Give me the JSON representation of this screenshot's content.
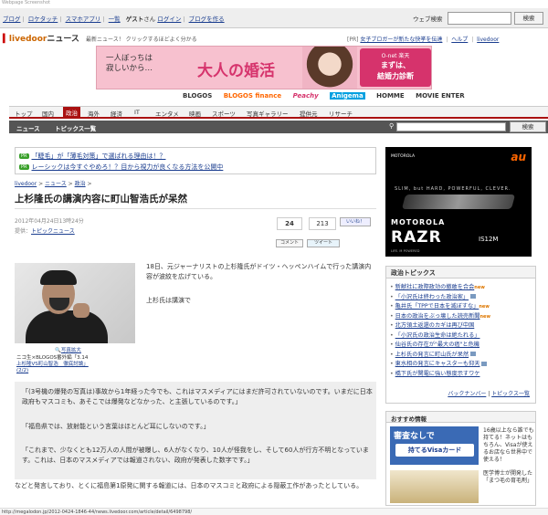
{
  "screenshot_label": "Webpage Screenshot",
  "topbar": {
    "links": [
      "ブログ",
      "ロケタッチ",
      "スマホアプリ",
      "一覧"
    ],
    "user_prefix": "ゲスト",
    "user_suffix": "さん",
    "login": "ログイン",
    "create_blog": "ブログを作る",
    "web_search_label": "ウェブ検索",
    "search_button": "検索"
  },
  "header": {
    "logo_brand": "livedoor",
    "logo_suffix": "ニュース",
    "ticker": "最新ニュース！ クリックするほどよく分かる",
    "pr_label": "[PR]",
    "pr_link": "女子ブロガーが新たな快挙を伝達",
    "help": "ヘルプ",
    "livedoor": "livedoor"
  },
  "banner": {
    "line1": "一人ぼっちは",
    "line2": "寂しいから…",
    "headline": "大人の婚活",
    "brand": "O-net 楽天",
    "cta1": "まずは、",
    "cta2": "結婚力診断"
  },
  "partners": [
    "BLOGOS",
    "BLOGOS finance",
    "Peachy",
    "Anigema",
    "HOMME",
    "MOVIE ENTER"
  ],
  "nav": {
    "items": [
      "トップ",
      "国内",
      "政治",
      "海外",
      "経済",
      "IT",
      "エンタメ",
      "映画",
      "スポーツ",
      "写真ギャラリー",
      "提供元",
      "リサーチ"
    ],
    "active_index": 2
  },
  "subnav": {
    "items": [
      "ニュース",
      "トピックス一覧"
    ],
    "search_button": "検索"
  },
  "pr_box": {
    "tag": "PR",
    "row1": "「睫毛」が「薄毛対策」で選ばれる理由は！？",
    "row2": "レーシックは今すぐやめろ！？目から視力が良くなる方法を公開中"
  },
  "breadcrumb": [
    "livedoor",
    "ニュース",
    "政治"
  ],
  "article": {
    "title": "上杉隆氏の講演内容に町山智浩氏が呆然",
    "date": "2012年04月24日13時24分",
    "source_prefix": "提供：",
    "source": "トピックニュース",
    "count_like": "24",
    "count_share": "213",
    "like_button": "いいね！",
    "comment_button": "コメント",
    "tweet_button": "ツイート",
    "photo_zoom": "写真拡大",
    "photo_caption_prefix": "ニコ生×BLOGOS番外編「3.14",
    "photo_caption_link": "上杉隆VS町山智浩　徹底討論」",
    "photo_caption_suffix": "(2/2)",
    "p1": "18日、元ジャーナリストの上杉隆氏がドイツ・ヘッペンハイムで行った講演内容が波紋を広げている。",
    "p2": "上杉氏は講演で",
    "q1": "「(3号機の爆発の写真は)事故から1年経った今でも、これはマスメディアにはまだ許可されていないのです。いまだに日本政府もマスコミも、あそこでは爆発などなかった、と主張しているのです。」",
    "q2": "「福島県では、放射能という言葉はほとんど耳にしないのです。」",
    "q3": "「これまで、少なくとも12万人の人間が被曝し、6人がなくなり、10人が怪我をし、そして60人が行方不明となっています。これは、日本のマスメディアでは報道されない、政府が発表した数字です。」",
    "after": "などと発言しており、とくに福島第1原発に関する報道には、日本のマスコミと政府による隠蔽工作があったとしている。"
  },
  "status_url": "http://megalodon.jp/2012-0424-1846-44/news.livedoor.com/article/detail/6498798/",
  "au_ad": {
    "brand": "au",
    "maker_small": "MOTOROLA",
    "slogan": "SLIM, but HARD, POWERFUL, CLEVER.",
    "maker": "MOTOROLA",
    "model": "RAZR",
    "code": "IS12M",
    "tagline": "LIFE. M POWERED"
  },
  "topics": {
    "title": "政治トピックス",
    "items": [
      {
        "text": "新献社に政際政効の撤敢を合会",
        "badge": "new"
      },
      {
        "text": "「小沢氏は終わった政治家」",
        "badge": "pic"
      },
      {
        "text": "亀井氏「TPPで日本を滅ぼすな」",
        "badge": "new"
      },
      {
        "text": "日本の政治をぶっ壊した読売新聞",
        "badge": "new"
      },
      {
        "text": "北方領土返還のカギは再び中国",
        "badge": ""
      },
      {
        "text": "「小沢氏の政治生命は絶たれる」",
        "badge": ""
      },
      {
        "text": "仙谷氏の存在が\"最大の癌\"と危機",
        "badge": ""
      },
      {
        "text": "上杉氏の発言に町山氏が呆然",
        "badge": "pic"
      },
      {
        "text": "東水相の発言にキャスターも仰天",
        "badge": "pic"
      },
      {
        "text": "橋下氏が関電に強い態度示すワケ",
        "badge": ""
      }
    ],
    "footer_backnumber": "バックナンバー",
    "footer_list": "トピックス一覧"
  },
  "reco": {
    "title": "おすすめ情報",
    "card1_line1": "審査なしで",
    "card1_line2": "持てるVisaカード",
    "txt1": "16歳以上なら誰でも持てる！ネットはもちろん、Visaが使えるお店なら世界中で使える！",
    "txt2": "医学博士が開発した「まつ毛の育毛剤」"
  }
}
